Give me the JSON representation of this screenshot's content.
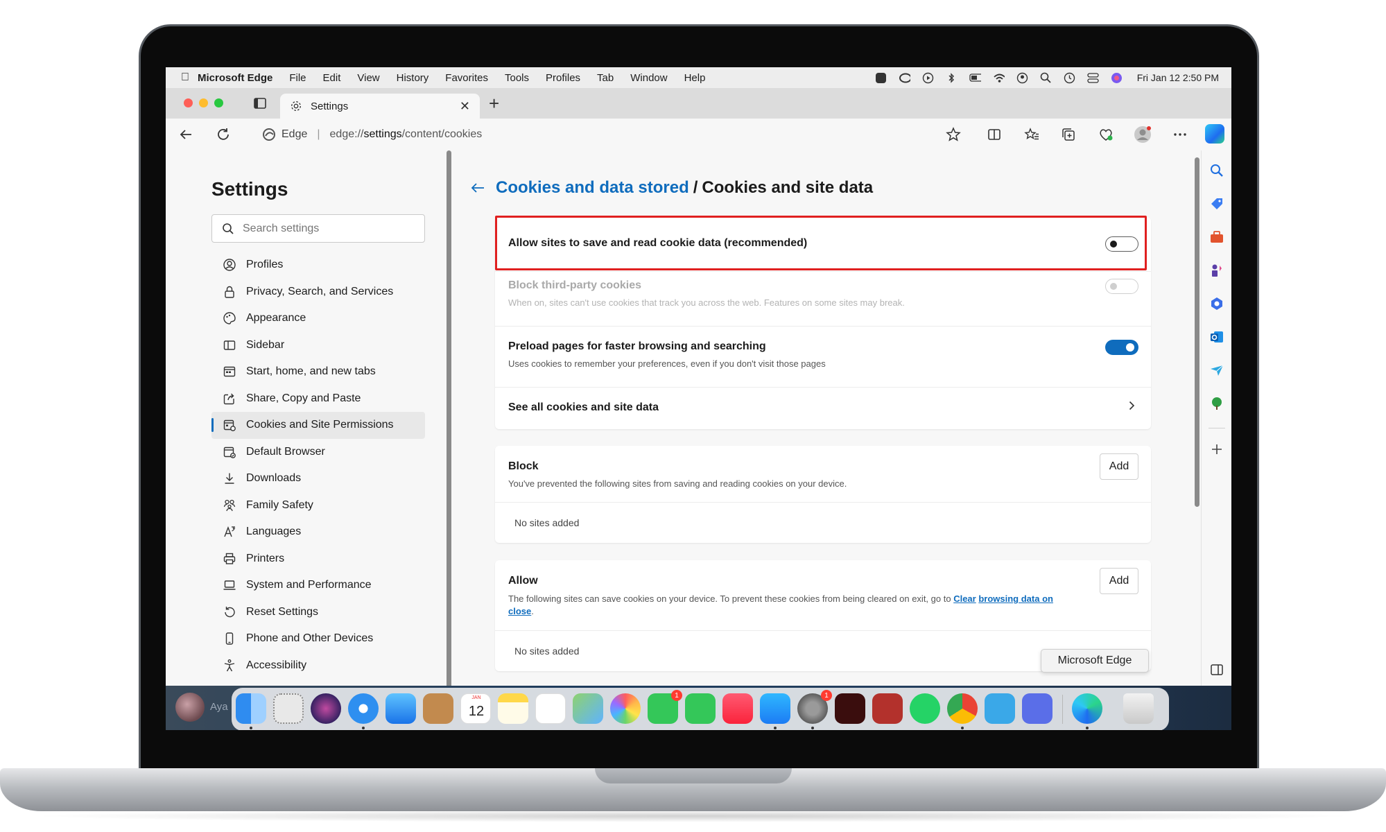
{
  "menubar": {
    "app": "Microsoft Edge",
    "items": [
      "File",
      "Edit",
      "View",
      "History",
      "Favorites",
      "Tools",
      "Profiles",
      "Tab",
      "Window",
      "Help"
    ],
    "clock": "Fri Jan 12  2:50 PM"
  },
  "tab": {
    "title": "Settings",
    "icon": "gear-icon"
  },
  "address": {
    "identity": "Edge",
    "url_prefix": "edge://",
    "url_bold": "settings",
    "url_suffix": "/content/cookies"
  },
  "sidebar": {
    "title": "Settings",
    "search_placeholder": "Search settings",
    "items": [
      {
        "label": "Profiles",
        "icon": "profile-icon"
      },
      {
        "label": "Privacy, Search, and Services",
        "icon": "lock-icon"
      },
      {
        "label": "Appearance",
        "icon": "palette-icon"
      },
      {
        "label": "Sidebar",
        "icon": "sidebar-icon"
      },
      {
        "label": "Start, home, and new tabs",
        "icon": "home-tabs-icon"
      },
      {
        "label": "Share, Copy and Paste",
        "icon": "share-icon"
      },
      {
        "label": "Cookies and Site Permissions",
        "icon": "cookie-permissions-icon",
        "active": true
      },
      {
        "label": "Default Browser",
        "icon": "browser-icon"
      },
      {
        "label": "Downloads",
        "icon": "download-icon"
      },
      {
        "label": "Family Safety",
        "icon": "family-icon"
      },
      {
        "label": "Languages",
        "icon": "language-icon"
      },
      {
        "label": "Printers",
        "icon": "printer-icon"
      },
      {
        "label": "System and Performance",
        "icon": "laptop-icon"
      },
      {
        "label": "Reset Settings",
        "icon": "reset-icon"
      },
      {
        "label": "Phone and Other Devices",
        "icon": "phone-icon"
      },
      {
        "label": "Accessibility",
        "icon": "accessibility-icon"
      }
    ]
  },
  "breadcrumb": {
    "parent": "Cookies and data stored",
    "separator": "/",
    "current": "Cookies and site data"
  },
  "settings": {
    "allow_cookies": {
      "label": "Allow sites to save and read cookie data (recommended)",
      "state": "off"
    },
    "block_third_party": {
      "label": "Block third-party cookies",
      "description": "When on, sites can't use cookies that track you across the web. Features on some sites may break.",
      "state": "disabled"
    },
    "preload": {
      "label": "Preload pages for faster browsing and searching",
      "description": "Uses cookies to remember your preferences, even if you don't visit those pages",
      "state": "on"
    },
    "see_all": {
      "label": "See all cookies and site data"
    }
  },
  "block_section": {
    "title": "Block",
    "description": "You've prevented the following sites from saving and reading cookies on your device.",
    "add_label": "Add",
    "empty": "No sites added"
  },
  "allow_section": {
    "title": "Allow",
    "description_prefix": "The following sites can save cookies on your device. To prevent these cookies from being cleared on exit, go to ",
    "description_link_1": "Clear",
    "description_link_2": "browsing data on close",
    "description_suffix": ".",
    "add_label": "Add",
    "empty": "No sites added"
  },
  "tooltip": "Microsoft Edge",
  "dock": {
    "user_name": "Aya",
    "calendar_month": "JAN",
    "calendar_day": "12",
    "badge_facetime": "1",
    "badge_settings": "1"
  },
  "colors": {
    "accent": "#0f6cbd",
    "highlight": "#e02020"
  }
}
